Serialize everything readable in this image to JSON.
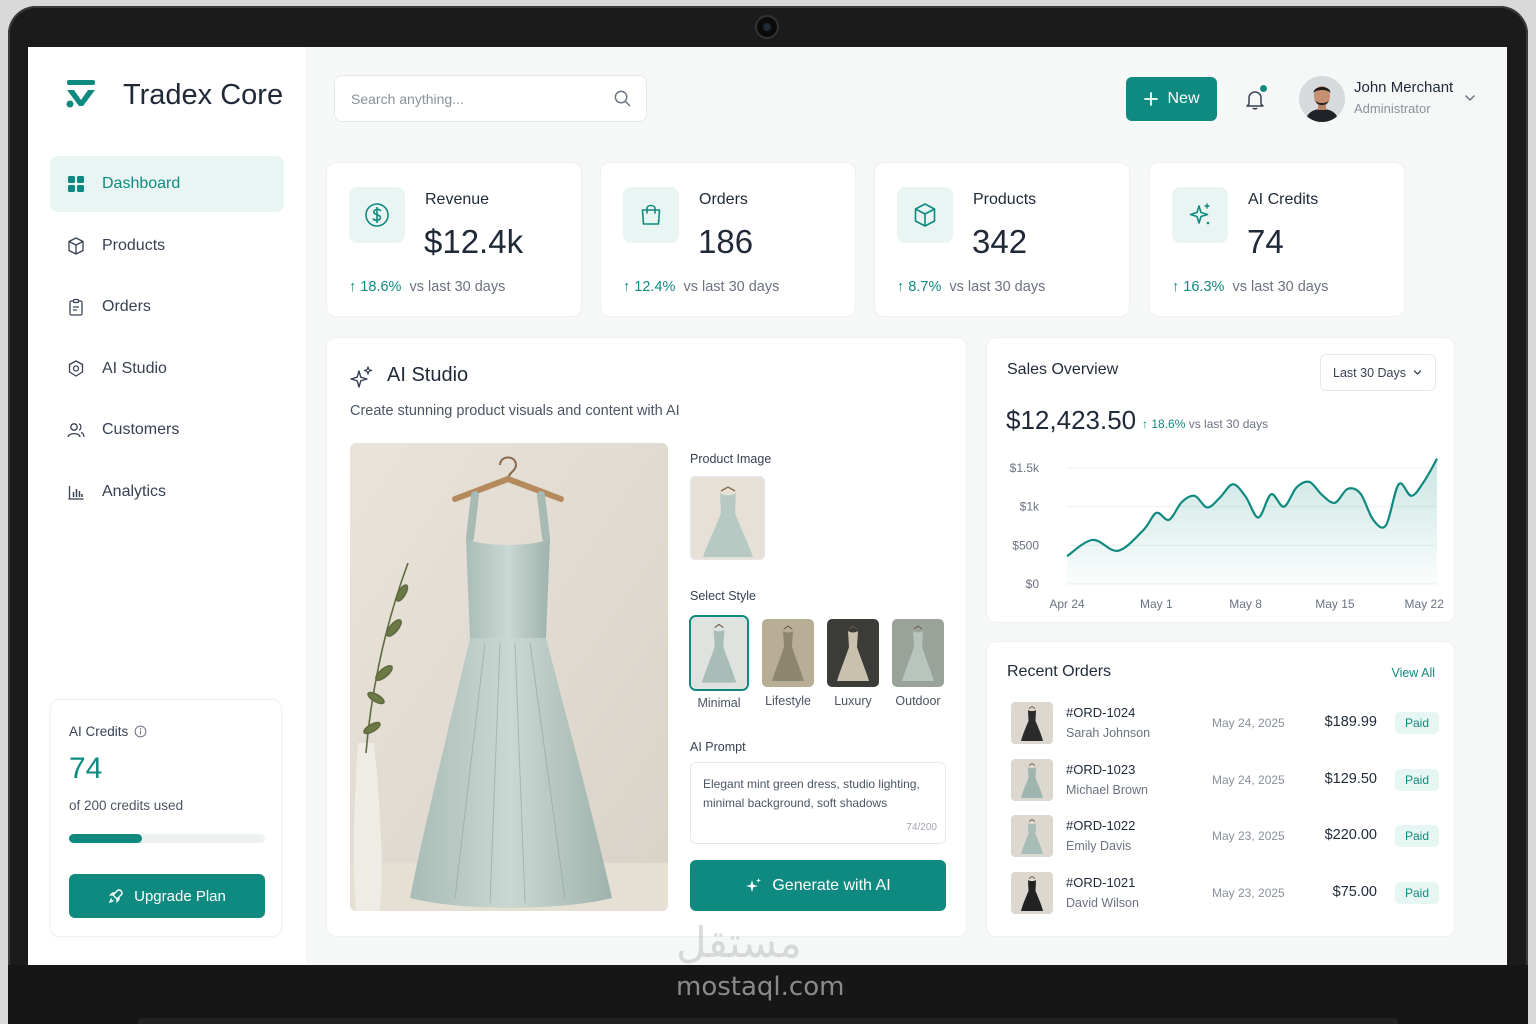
{
  "app": {
    "name": "Tradex Core"
  },
  "header": {
    "search_placeholder": "Search anything...",
    "new_label": "New",
    "user": {
      "name": "John Merchant",
      "role": "Administrator"
    }
  },
  "nav": [
    {
      "label": "Dashboard",
      "icon": "dashboard-grid-icon",
      "active": true
    },
    {
      "label": "Products",
      "icon": "box-icon"
    },
    {
      "label": "Orders",
      "icon": "clipboard-icon"
    },
    {
      "label": "AI Studio",
      "icon": "ai-settings-icon"
    },
    {
      "label": "Customers",
      "icon": "users-icon"
    },
    {
      "label": "Analytics",
      "icon": "bar-chart-icon"
    }
  ],
  "credits_card": {
    "title": "AI Credits",
    "value": "74",
    "subtitle": "of 200 credits used",
    "progress_fraction": 0.37,
    "button_label": "Upgrade Plan"
  },
  "stats": [
    {
      "label": "Revenue",
      "value": "$12.4k",
      "delta": "18.6%",
      "delta_suffix": "vs last 30 days",
      "icon": "dollar-icon"
    },
    {
      "label": "Orders",
      "value": "186",
      "delta": "12.4%",
      "delta_suffix": "vs last 30 days",
      "icon": "shopping-bag-icon"
    },
    {
      "label": "Products",
      "value": "342",
      "delta": "8.7%",
      "delta_suffix": "vs last 30 days",
      "icon": "cube-icon"
    },
    {
      "label": "AI Credits",
      "value": "74",
      "delta": "16.3%",
      "delta_suffix": "vs last 30 days",
      "icon": "sparkle-icon"
    }
  ],
  "studio": {
    "title": "AI Studio",
    "subtitle": "Create stunning product visuals and content with AI",
    "product_image_label": "Product Image",
    "select_style_label": "Select Style",
    "styles": [
      {
        "label": "Minimal",
        "selected": true
      },
      {
        "label": "Lifestyle"
      },
      {
        "label": "Luxury"
      },
      {
        "label": "Outdoor"
      }
    ],
    "prompt_label": "AI Prompt",
    "prompt_text": "Elegant mint green dress, studio lighting, minimal background, soft shadows",
    "prompt_count": "74/200",
    "generate_label": "Generate with AI"
  },
  "sales": {
    "title": "Sales Overview",
    "range": "Last 30 Days",
    "total": "$12,423.50",
    "delta": "18.6%",
    "delta_suffix": "vs last 30 days"
  },
  "chart_data": {
    "type": "area",
    "title": "Sales Overview",
    "x_tick_labels": [
      "Apr 24",
      "May 1",
      "May 8",
      "May 15",
      "May 22"
    ],
    "y_tick_labels": [
      "$1.5k",
      "$1k",
      "$500",
      "$0"
    ],
    "ylim": [
      0,
      1500
    ],
    "grid": true,
    "color": "#0f8a80",
    "x": [
      0,
      2,
      4,
      6,
      7,
      8,
      9,
      10,
      11,
      12,
      13,
      14,
      15,
      16,
      17,
      18,
      19,
      20,
      21,
      22,
      23,
      24,
      25,
      26,
      27,
      28,
      29
    ],
    "values": [
      360,
      570,
      430,
      700,
      920,
      830,
      1060,
      1140,
      990,
      1120,
      1290,
      1130,
      860,
      1160,
      1000,
      1250,
      1320,
      1150,
      1050,
      1230,
      1170,
      830,
      760,
      1290,
      1140,
      1330,
      1620
    ]
  },
  "orders": {
    "title": "Recent Orders",
    "view_all": "View All",
    "rows": [
      {
        "id": "#ORD-1024",
        "customer": "Sarah Johnson",
        "date": "May 24, 2025",
        "amount": "$189.99",
        "status": "Paid",
        "dress": "#2b2b2b"
      },
      {
        "id": "#ORD-1023",
        "customer": "Michael Brown",
        "date": "May 24, 2025",
        "amount": "$129.50",
        "status": "Paid",
        "dress": "#9fb5b0"
      },
      {
        "id": "#ORD-1022",
        "customer": "Emily Davis",
        "date": "May 23, 2025",
        "amount": "$220.00",
        "status": "Paid",
        "dress": "#a9bdb8"
      },
      {
        "id": "#ORD-1021",
        "customer": "David Wilson",
        "date": "May 23, 2025",
        "amount": "$75.00",
        "status": "Paid",
        "dress": "#222222"
      }
    ]
  },
  "watermark": {
    "logo": "مستقل",
    "text": "mostaql.com"
  }
}
